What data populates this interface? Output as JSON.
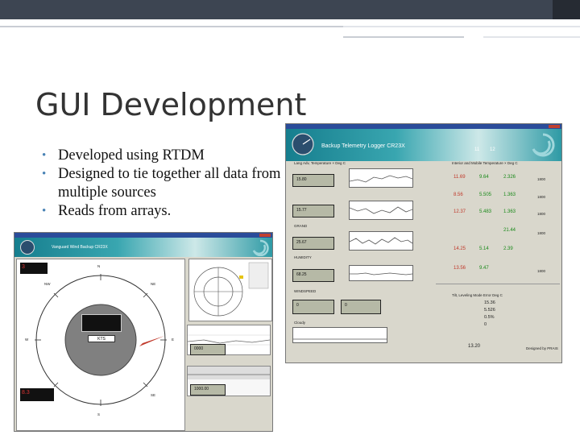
{
  "slide": {
    "title": "GUI Development",
    "bullets": [
      "Developed using RTDM",
      "Designed to tie together all data from multiple sources",
      "Reads from arrays."
    ]
  },
  "tdl_window": {
    "title": "Backup Telemetry Logger CR23X",
    "labels": {
      "left_top": "Lang Adv, Temperature × Deg C",
      "grand": "GRAND",
      "humidity": "HUMIDITY",
      "windspeed": "WINDSPEED",
      "cloudy": "Cloudy",
      "lower_table_head": "Tilt, Leveling Mode Error Deg C",
      "trend_head": "Interior and Mobile Temperature × Deg C",
      "bottom_right": "Designed by PRAIS"
    },
    "lcd_values": [
      "15.80",
      "15.77",
      "25.67",
      "68.25",
      "0",
      "0"
    ],
    "red_values": [
      "11.69",
      "8.56",
      "12.37",
      "14.25",
      "13.56"
    ],
    "green_values": [
      "9.64",
      "5.505",
      "5.483",
      "5.14",
      "9.47"
    ],
    "dark_values": [
      "2.326",
      "1.363",
      "1.363",
      "21.44",
      "2.39"
    ],
    "small_cols": [
      "1800",
      "1800",
      "1800",
      "1800",
      "1800"
    ],
    "right_block": [
      "15.36",
      "5.526",
      "0.5%",
      "0"
    ],
    "time_values": [
      "11",
      "12",
      "13.20"
    ]
  },
  "wind_window": {
    "title": "Vanguard Wind Backup CR23X",
    "lcd_red_1": "3",
    "lcd_red_2": "8.3",
    "knots_label": "KTS",
    "readout_1": "0000",
    "readout_2": "1000.00",
    "compass_labels": [
      "N",
      "NE",
      "E",
      "SE",
      "S",
      "SW",
      "W",
      "NW"
    ]
  }
}
